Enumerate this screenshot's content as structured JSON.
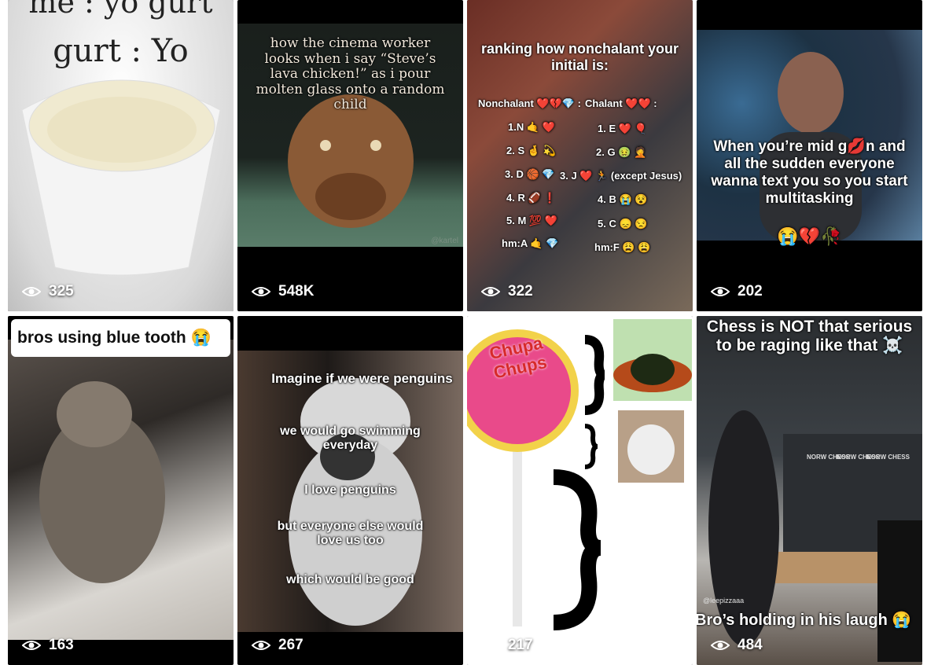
{
  "tiles": [
    {
      "views": "325",
      "caption": "gurt : Yo",
      "caption_top": "me : yo gurt"
    },
    {
      "views": "548K",
      "caption": "how the cinema worker looks when i say “Steve’s lava chicken!” as i pour molten glass onto a random child",
      "watermark": "@kartel"
    },
    {
      "views": "322",
      "title": "ranking how nonchalant your initial is:",
      "left_head": "Nonchalant ❤️💔💎 :",
      "right_head": "Chalant ❤️❤️ :",
      "left_items": [
        "1.N 🤙 ❤️",
        "2. S 🤞 💫",
        "3. D 🏀 💎",
        "4. R 🏈 ❗",
        "5. M 💯 ❤️"
      ],
      "right_items": [
        "1. E ❤️ 🎈",
        "2. G 🤢 🤦",
        "3. J ❤️ 🏃 (except Jesus)",
        "4. B 😭 😵",
        "5. C 😞 😒"
      ],
      "hm_left": "hm:A 🤙 💎",
      "hm_right": "hm:F 😩 😩"
    },
    {
      "views": "202",
      "caption": "When you’re mid g💋n and all the sudden everyone wanna text you so you start multitasking",
      "emoji": "😭💔🥀"
    },
    {
      "views": "163",
      "caption": "bros using blue tooth 😭"
    },
    {
      "views": "267",
      "lines": [
        "Imagine if we were penguins",
        "we would go swimming everyday",
        "I love penguins",
        "but everyone else would love us too",
        "which would be good"
      ]
    },
    {
      "views": "217",
      "brand": "Chupa Chups"
    },
    {
      "views": "484",
      "caption": "Chess is NOT that serious to be raging like that ☠️",
      "bottom": "Bro’s holding in his laugh 😭",
      "watermark": "@leepizzaaa",
      "banner": [
        "NORW CHESS",
        "NORW CHESS",
        "NORW CHESS"
      ]
    }
  ],
  "colors": {
    "background": "#ffffff",
    "tile": "#000000",
    "text": "#ffffff"
  }
}
